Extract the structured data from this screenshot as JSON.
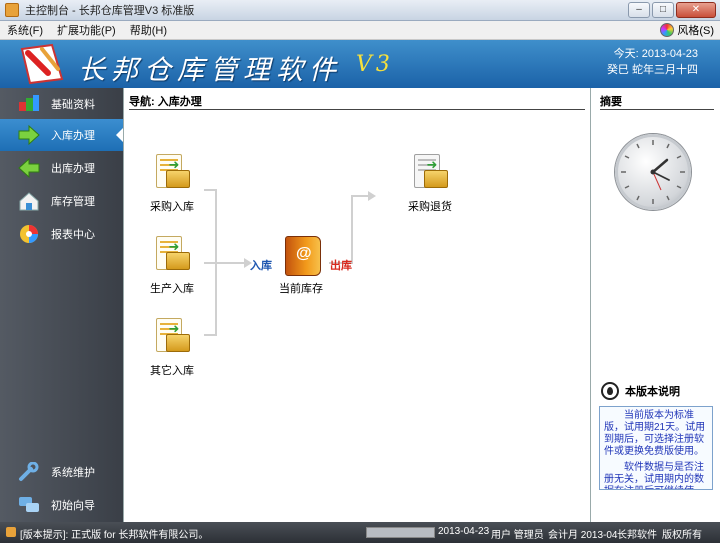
{
  "window": {
    "title": "主控制台 - 长邦仓库管理V3 标准版",
    "minimize": "–",
    "maximize": "□",
    "close": "✕"
  },
  "menu": {
    "items": [
      "系统(F)",
      "扩展功能(P)",
      "帮助(H)"
    ],
    "style_label": "风格(S)"
  },
  "banner": {
    "brand": "长邦仓库管理软件",
    "version": "V3",
    "today": "今天: 2013-04-23",
    "lunar": "癸巳 蛇年三月十四"
  },
  "sidebar": {
    "items": [
      {
        "label": "基础资料",
        "icon": "cubes-icon"
      },
      {
        "label": "入库办理",
        "icon": "arrow-right-icon",
        "active": true
      },
      {
        "label": "出库办理",
        "icon": "arrow-left-icon"
      },
      {
        "label": "库存管理",
        "icon": "house-icon"
      },
      {
        "label": "报表中心",
        "icon": "chart-wheel-icon"
      }
    ],
    "bottom_items": [
      {
        "label": "系统维护",
        "icon": "wrench-icon"
      },
      {
        "label": "初始向导",
        "icon": "chat-bubbles-icon"
      }
    ]
  },
  "main": {
    "header": "导航: 入库办理",
    "nodes": {
      "purchase_in": "采购入库",
      "production_in": "生产入库",
      "other_in": "其它入库",
      "current_stock": "当前库存",
      "purchase_return": "采购退货"
    },
    "flow_in": "入库",
    "flow_out": "出库"
  },
  "right": {
    "header": "摘要",
    "note_title": "本版本说明",
    "note_p1": "当前版本为标准版，试用期21天。试用到期后，可选择注册软件或更换免费版使用。",
    "note_p2": "软件数据与是否注册无关，试用期内的数据在注册后可继续使用。"
  },
  "status": {
    "notice": "[版本提示]: 正式版 for 长邦软件有限公司。",
    "date": "2013-04-23",
    "user": "用户 管理员",
    "period": "会计月 2013-04",
    "company": "长邦软件",
    "copyright": "版权所有"
  }
}
